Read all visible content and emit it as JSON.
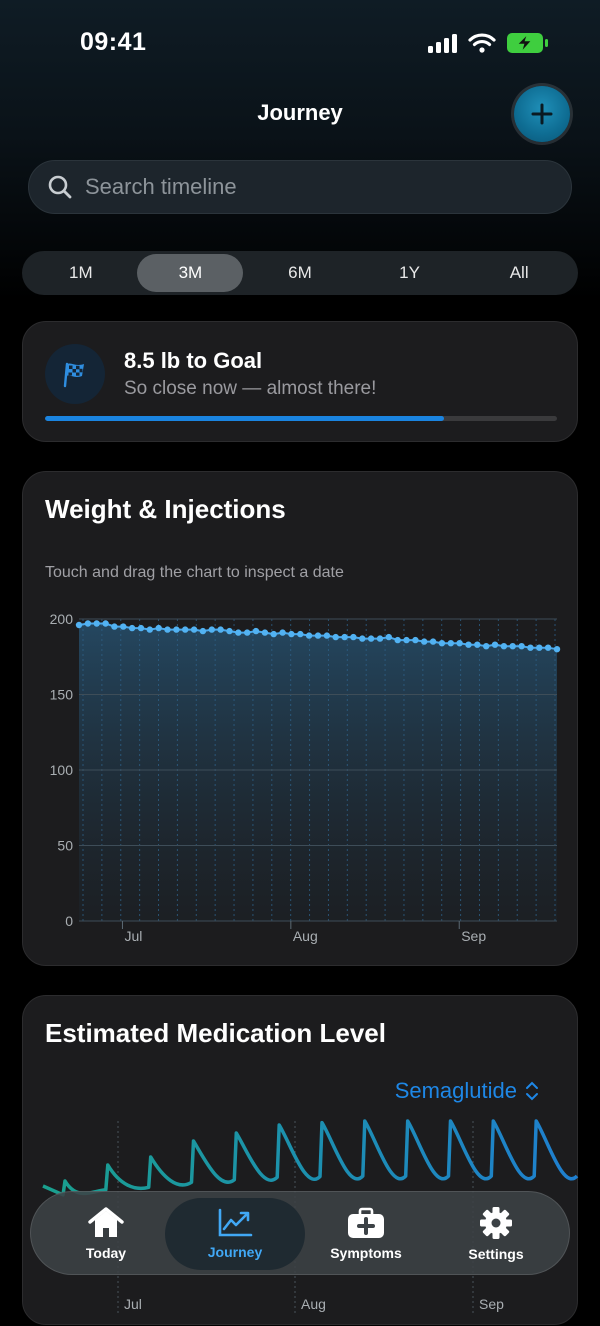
{
  "status": {
    "time": "09:41"
  },
  "nav": {
    "title": "Journey"
  },
  "search": {
    "placeholder": "Search timeline"
  },
  "ranges": [
    "1M",
    "3M",
    "6M",
    "1Y",
    "All"
  ],
  "active_range": "3M",
  "goal": {
    "title": "8.5 lb to Goal",
    "subtitle": "So close now — almost there!",
    "progress": 0.78
  },
  "weight_chart": {
    "title": "Weight & Injections",
    "hint": "Touch and drag the chart to inspect a date"
  },
  "medication": {
    "title": "Estimated Medication Level",
    "selected_drug": "Semaglutide"
  },
  "chart_data": [
    {
      "type": "line",
      "title": "Weight & Injections",
      "ylim": [
        0,
        200
      ],
      "yticks": [
        0,
        50,
        100,
        150,
        200
      ],
      "xticks": [
        "Jul",
        "Aug",
        "Sep"
      ],
      "x_start": "2024-06-23",
      "x_end": "2024-09-19",
      "grid": true,
      "series": [
        {
          "values": [
            196,
            197,
            197,
            197,
            195,
            195,
            194,
            194,
            193,
            194,
            193,
            193,
            193,
            193,
            192,
            193,
            193,
            192,
            191,
            191,
            192,
            191,
            190,
            191,
            190,
            190,
            189,
            189,
            189,
            188,
            188,
            188,
            187,
            187,
            187,
            188,
            186,
            186,
            186,
            185,
            185,
            184,
            184,
            184,
            183,
            183,
            182,
            183,
            182,
            182,
            182,
            181,
            181,
            181,
            180
          ]
        }
      ],
      "injection_markers": 26
    },
    {
      "type": "line",
      "title": "Estimated Medication Level",
      "xticks": [
        "Jul",
        "Aug",
        "Sep"
      ],
      "series": [
        {
          "name": "Semaglutide",
          "values": [
            0.25,
            0.45,
            0.55,
            0.75,
            0.85,
            0.95,
            0.98,
            1.0,
            1.0,
            1.0,
            1.0,
            1.0
          ]
        }
      ]
    }
  ],
  "tabs": [
    {
      "label": "Today",
      "icon": "house-icon"
    },
    {
      "label": "Journey",
      "icon": "chart-trend-icon"
    },
    {
      "label": "Symptoms",
      "icon": "medkit-icon"
    },
    {
      "label": "Settings",
      "icon": "gear-icon"
    }
  ],
  "active_tab": "Journey",
  "colors": {
    "accent": "#1e87e6",
    "weight_line": "#4aa8ec",
    "med_line": "#1a8fa6"
  }
}
